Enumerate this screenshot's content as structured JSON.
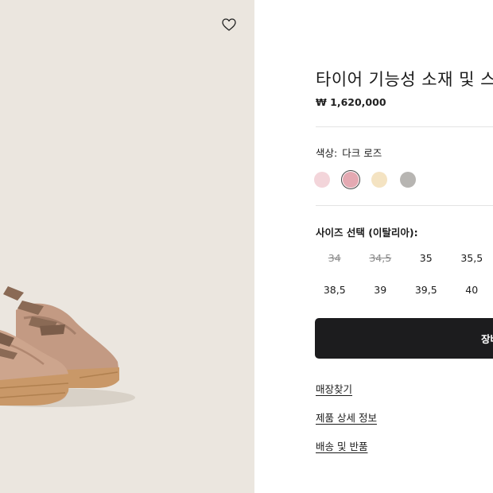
{
  "product": {
    "title": "타이어 기능성 소재 및 스",
    "price": "₩ 1,620,000"
  },
  "icons": {
    "wishlist": "heart-icon"
  },
  "color": {
    "label": "색상:",
    "selected_name": "다크 로즈",
    "swatches": [
      {
        "name": "pale-pink",
        "hex": "#f3d5da",
        "selected": false
      },
      {
        "name": "dark-rose",
        "hex": "#e4a9b2",
        "selected": true
      },
      {
        "name": "cream",
        "hex": "#f4e3c2",
        "selected": false
      },
      {
        "name": "grey",
        "hex": "#b7b5b2",
        "selected": false
      }
    ]
  },
  "size": {
    "label": "사이즈 선택 (이탈리아):",
    "options": [
      {
        "value": "34",
        "available": false
      },
      {
        "value": "34,5",
        "available": false
      },
      {
        "value": "35",
        "available": true
      },
      {
        "value": "35,5",
        "available": true
      },
      {
        "value": "38,5",
        "available": true
      },
      {
        "value": "39",
        "available": true
      },
      {
        "value": "39,5",
        "available": true
      },
      {
        "value": "40",
        "available": true
      }
    ]
  },
  "cart_button": {
    "label": "장바"
  },
  "links": {
    "store_finder": "매장찾기",
    "product_details": "제품 상세 정보",
    "shipping_returns": "배송 및 반품"
  },
  "colors": {
    "image_background": "#ebe6df",
    "button_background": "#1c1c1e",
    "shoe_suede": "#c9a089",
    "shoe_sole": "#c99868",
    "shoe_laces": "#8a6a55"
  }
}
